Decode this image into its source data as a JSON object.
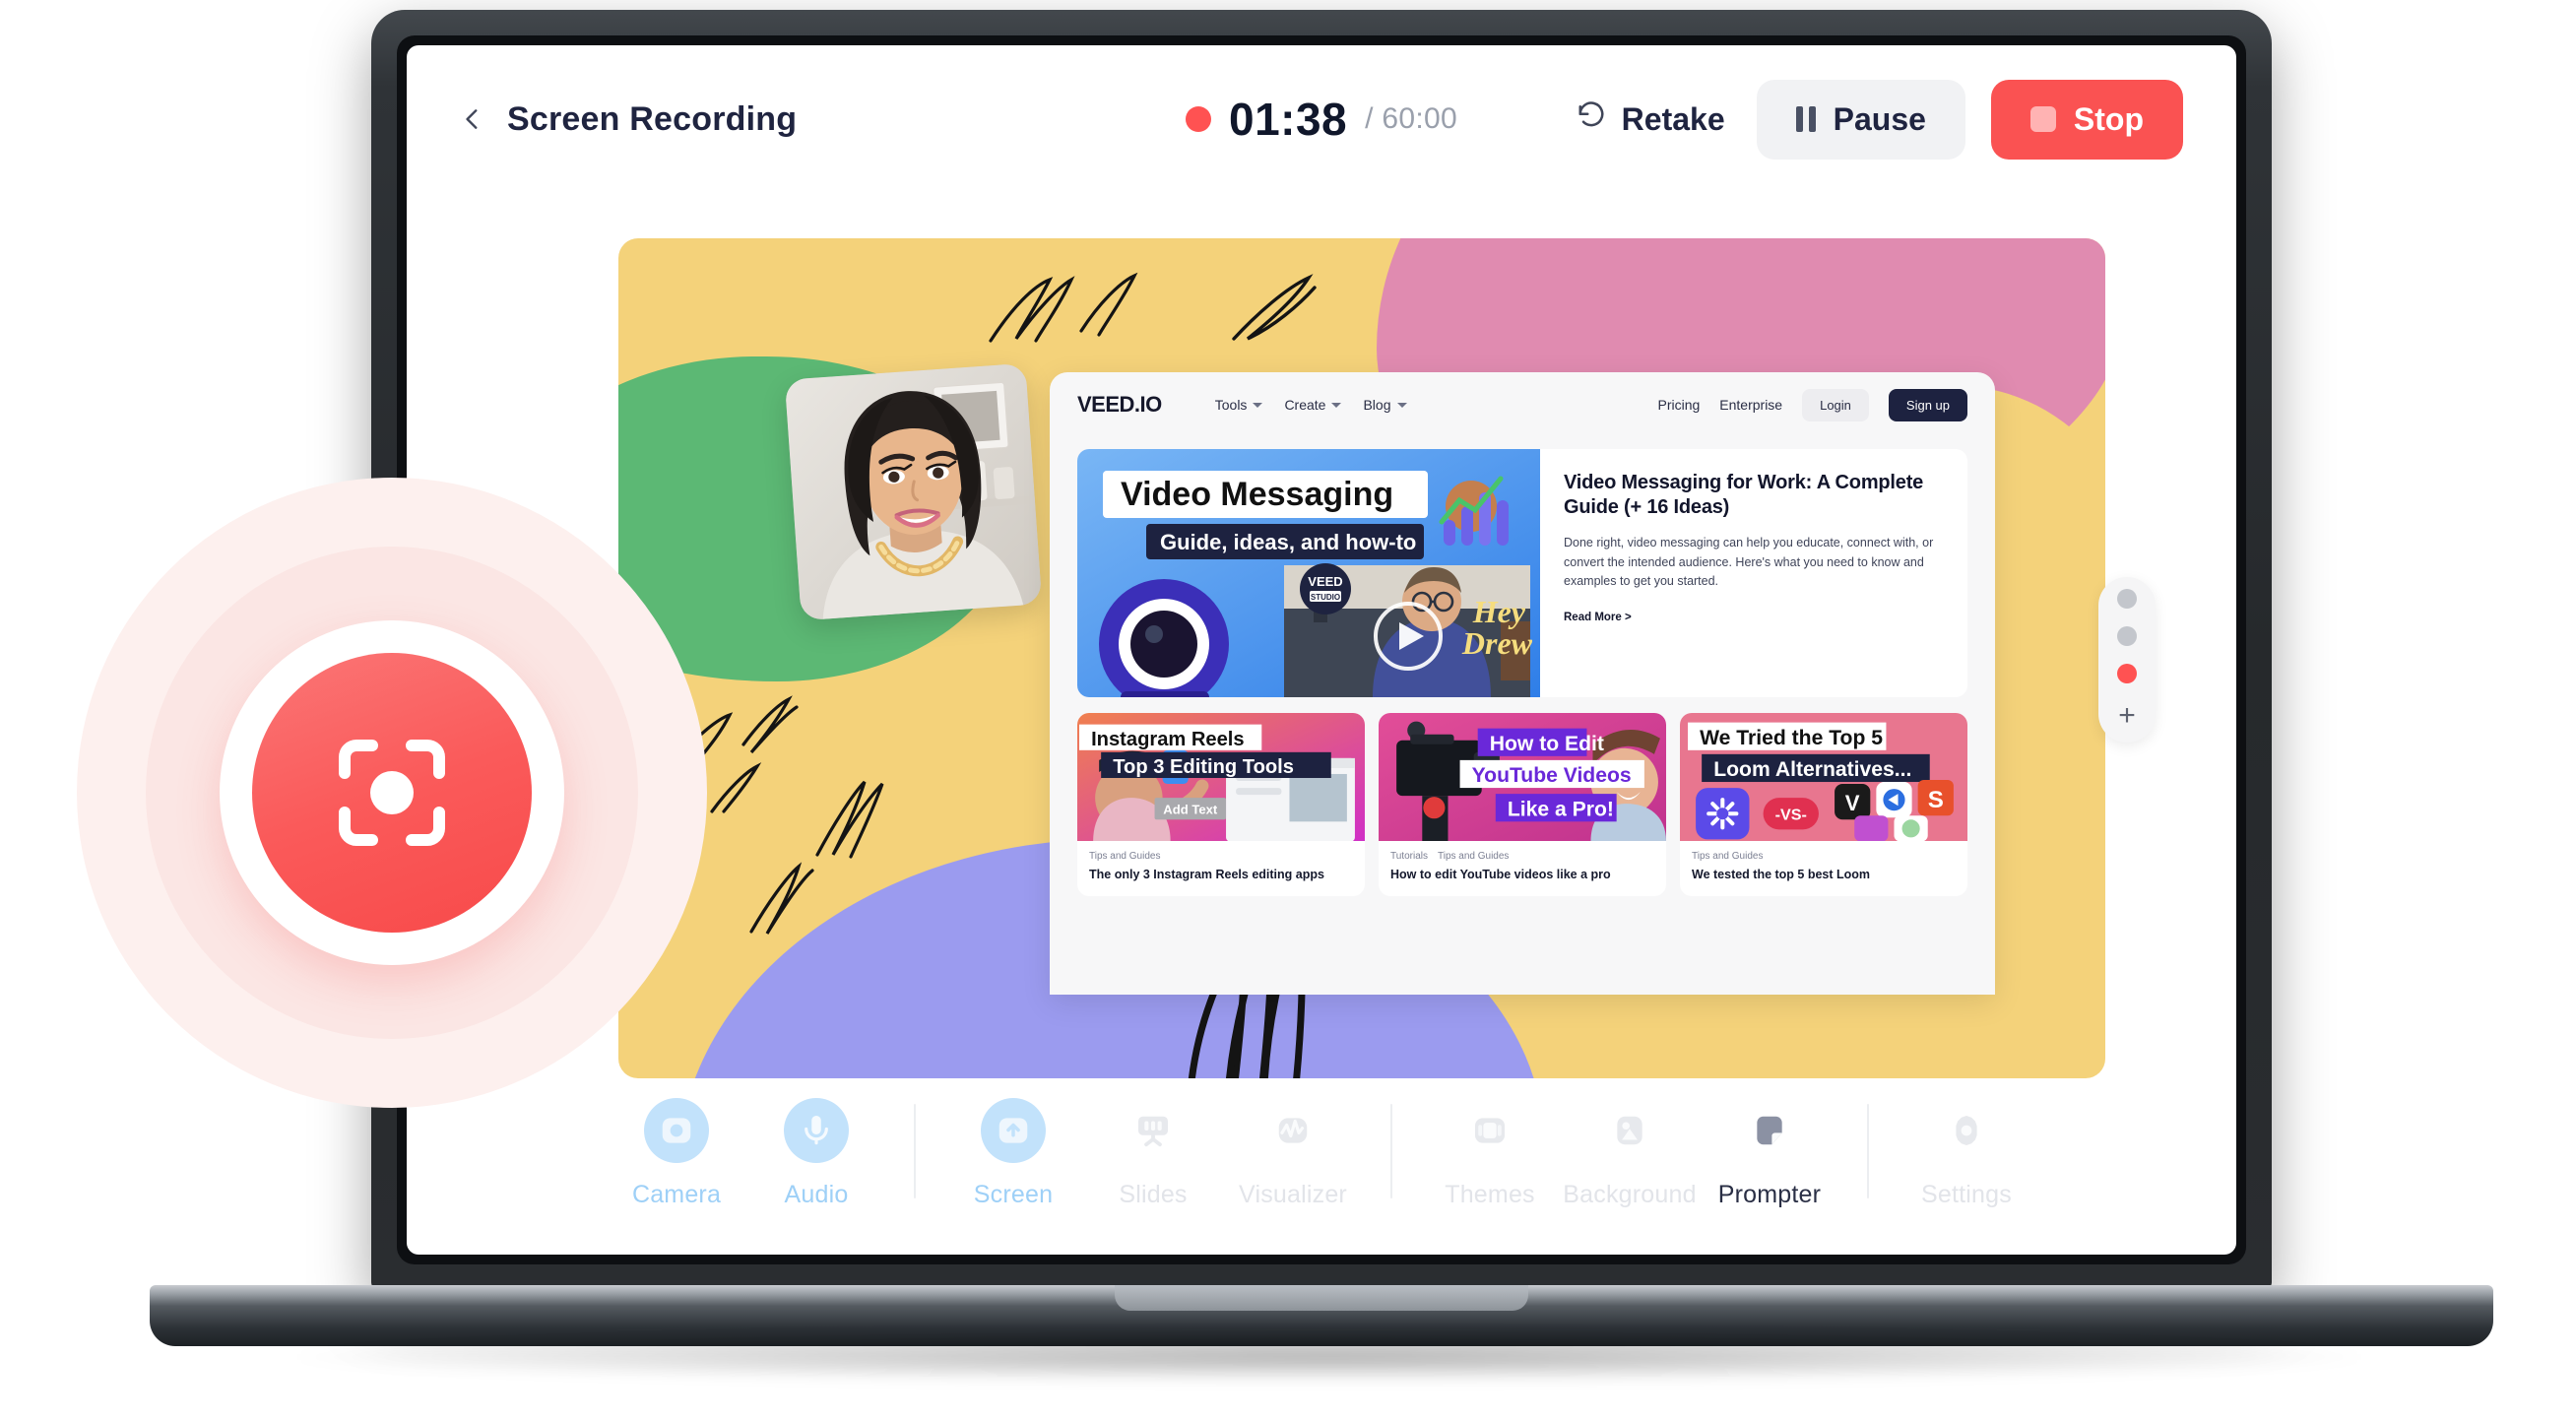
{
  "app": {
    "title": "Screen Recording",
    "back_icon": "chevron-left-icon"
  },
  "timer": {
    "current": "01:38",
    "separator": "/",
    "total": "60:00",
    "rec_dot_color": "#ff5252"
  },
  "controls": {
    "retake_label": "Retake",
    "retake_icon": "rotate-ccw-icon",
    "pause_label": "Pause",
    "pause_icon": "pause-icon",
    "stop_label": "Stop",
    "stop_icon": "stop-square-icon",
    "stop_color": "#fa5252"
  },
  "canvas": {
    "background_color": "#f4d27a",
    "blobs": [
      {
        "name": "green-blob",
        "color": "#5cb874"
      },
      {
        "name": "pink-blob",
        "color": "#e08bb0"
      },
      {
        "name": "purple-blob",
        "color": "#9b9bef"
      }
    ],
    "webcam_label": "webcam-overlay"
  },
  "site": {
    "brand": "VEED.IO",
    "nav": [
      {
        "label": "Tools",
        "has_caret": true
      },
      {
        "label": "Create",
        "has_caret": true
      },
      {
        "label": "Blog",
        "has_caret": true
      }
    ],
    "nav_right": [
      {
        "label": "Pricing"
      },
      {
        "label": "Enterprise"
      }
    ],
    "login_label": "Login",
    "signup_label": "Sign up",
    "hero": {
      "thumb_title": "Video Messaging",
      "thumb_subtitle": "Guide, ideas, and how-to",
      "thumb_badge_top": "VEED",
      "thumb_badge_bottom": "STUDIO",
      "thumb_caption": "Hey Drew",
      "title": "Video Messaging for Work: A Complete Guide (+ 16 Ideas)",
      "description": "Done right, video messaging can help you educate, connect with, or convert the intended audience. Here's what you need to know and examples to get you started.",
      "read_more": "Read More >"
    },
    "cards": [
      {
        "thumb_line1": "Instagram Reels",
        "thumb_line2": "Top 3 Editing Tools",
        "thumb_extra": "Add Text",
        "tags": [
          "Tips and Guides"
        ],
        "title": "The only 3 Instagram Reels editing apps"
      },
      {
        "thumb_line1": "How to Edit",
        "thumb_line2": "YouTube Videos",
        "thumb_line3": "Like a Pro!",
        "tags": [
          "Tutorials",
          "Tips and Guides"
        ],
        "title": "How to edit YouTube videos like a pro"
      },
      {
        "thumb_line1": "We Tried the Top 5",
        "thumb_line2": "Loom Alternatives...",
        "thumb_extra": "-VS-",
        "tags": [
          "Tips and Guides"
        ],
        "title": "We tested the top 5 best Loom"
      }
    ]
  },
  "dots_panel": {
    "items": [
      {
        "name": "layout-dot-1",
        "active": false
      },
      {
        "name": "layout-dot-2",
        "active": false
      },
      {
        "name": "layout-dot-3",
        "active": true
      }
    ],
    "add_label": "+",
    "active_color": "#ff5252",
    "inactive_color": "#c3c6cc"
  },
  "toolbar": {
    "items": [
      {
        "label": "Camera",
        "icon": "camera-icon",
        "state": "on"
      },
      {
        "label": "Audio",
        "icon": "microphone-icon",
        "state": "on"
      },
      {
        "label": "Screen",
        "icon": "screen-share-icon",
        "state": "on"
      },
      {
        "label": "Slides",
        "icon": "slides-icon",
        "state": "off"
      },
      {
        "label": "Visualizer",
        "icon": "waveform-icon",
        "state": "off"
      },
      {
        "label": "Themes",
        "icon": "themes-icon",
        "state": "off"
      },
      {
        "label": "Background",
        "icon": "image-icon",
        "state": "off"
      },
      {
        "label": "Prompter",
        "icon": "prompter-icon",
        "state": "sel"
      },
      {
        "label": "Settings",
        "icon": "gear-icon",
        "state": "off"
      }
    ]
  },
  "record_overlay": {
    "icon": "record-capture-icon",
    "color": "#fa5252"
  }
}
